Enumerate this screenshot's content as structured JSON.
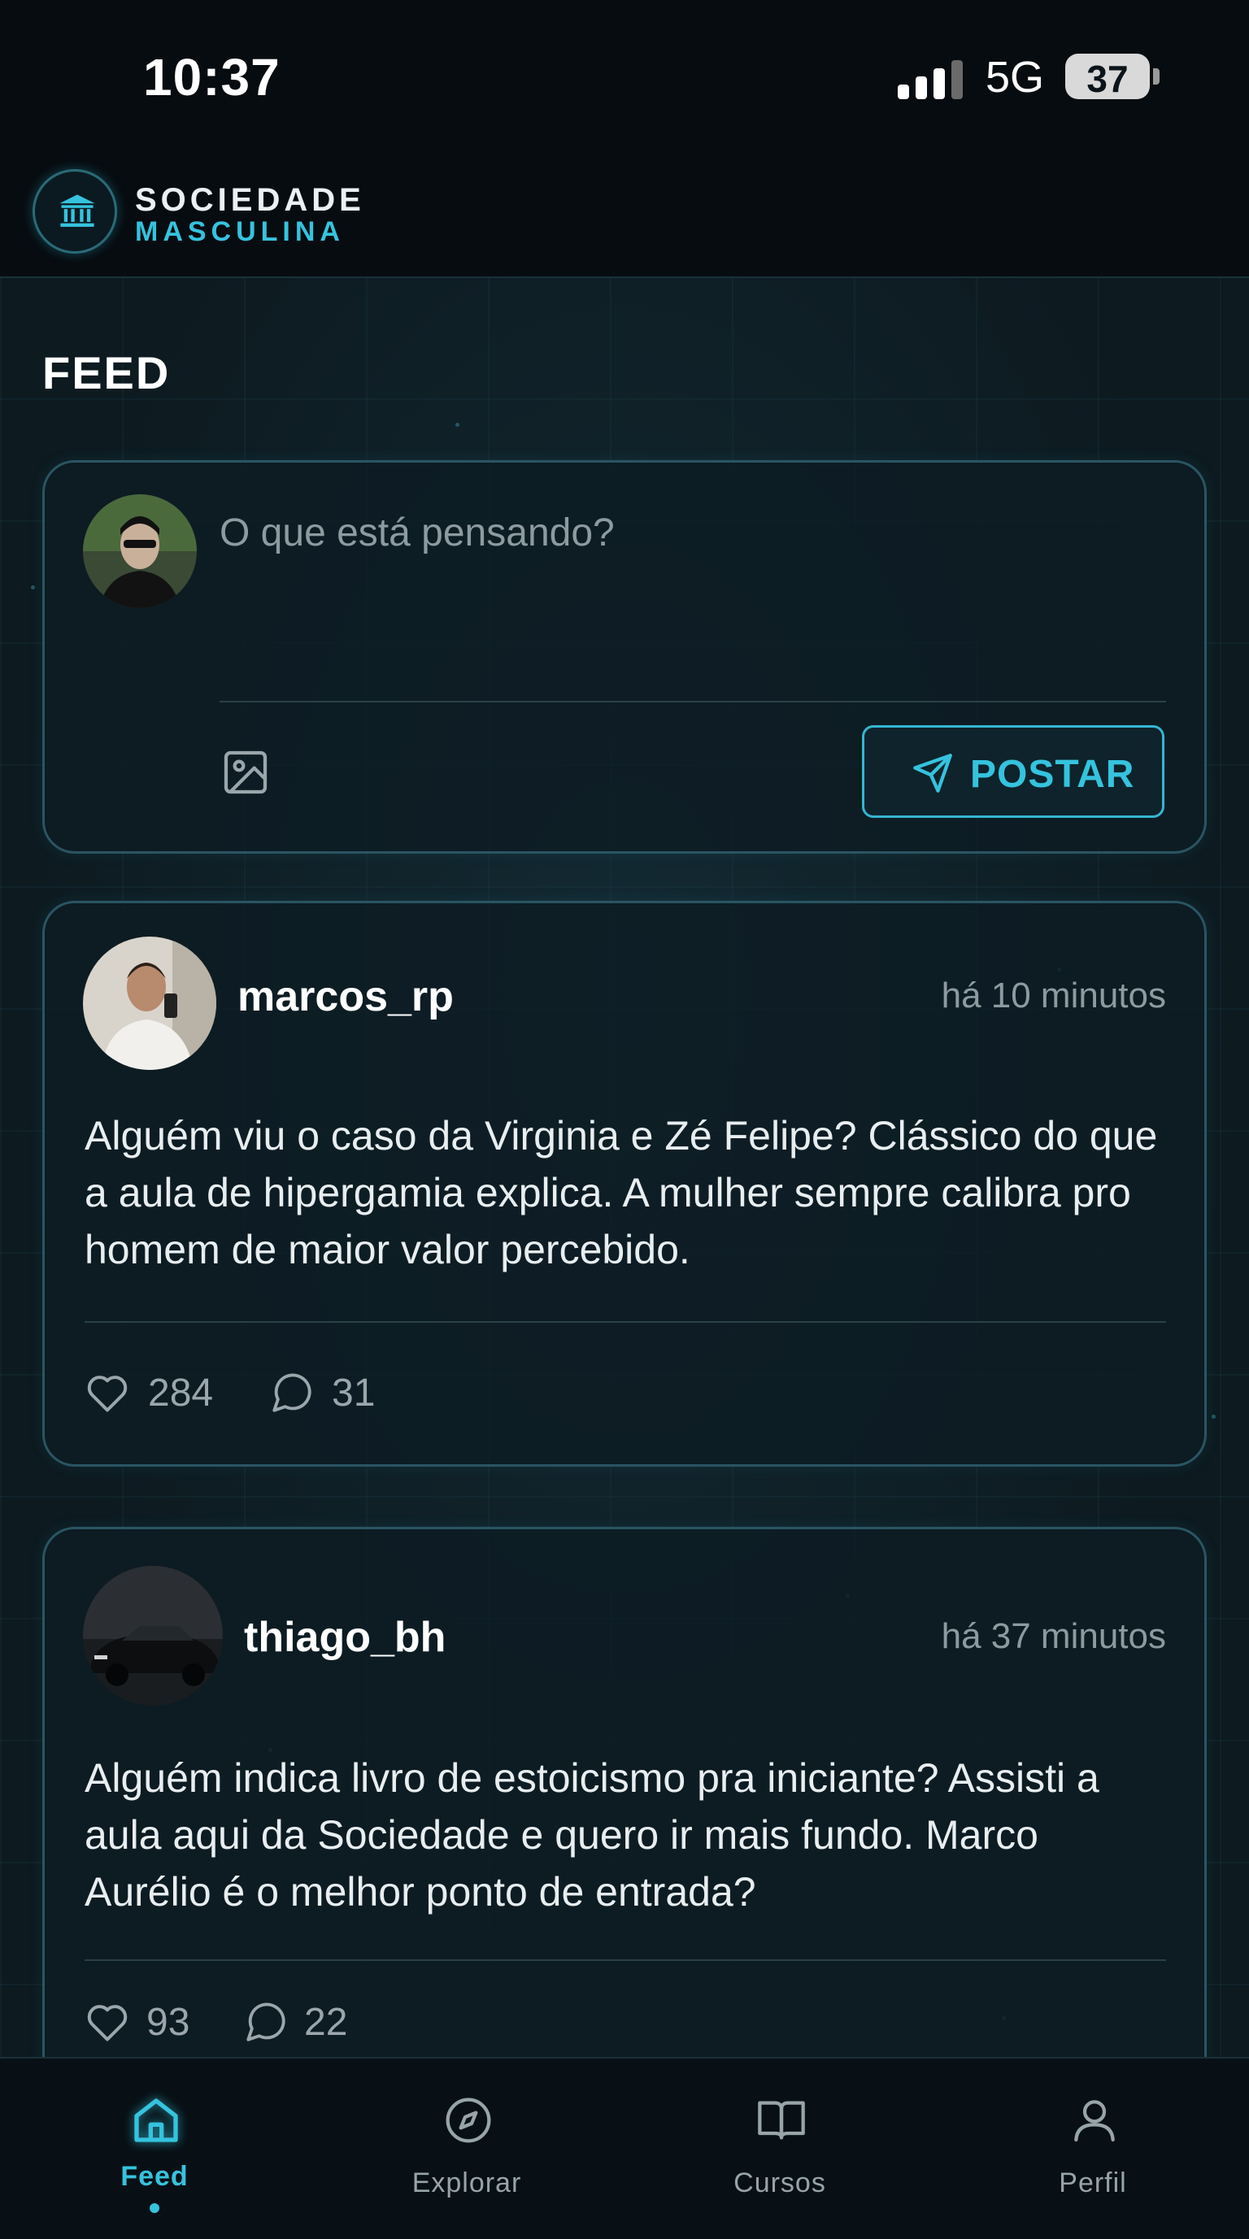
{
  "status_bar": {
    "time": "10:37",
    "network": "5G",
    "battery": "37"
  },
  "header": {
    "brand_line1": "SOCIEDADE",
    "brand_line2": "MASCULINA",
    "logo_icon": "bank-icon"
  },
  "page_title": "FEED",
  "composer": {
    "placeholder": "O que está pensando?",
    "post_label": "POSTAR",
    "image_icon": "image-icon",
    "send_icon": "send-icon"
  },
  "posts": [
    {
      "username": "marcos_rp",
      "time": "há 10 minutos",
      "body": "Alguém viu o caso da Virginia e Zé Felipe? Clássico do que a aula de hipergamia explica. A mulher sempre calibra pro homem de maior valor percebido.",
      "likes": "284",
      "comments": "31"
    },
    {
      "username": "thiago_bh",
      "time": "há 37 minutos",
      "body": "Alguém indica livro de estoicismo pra iniciante? Assisti a aula aqui da Sociedade e quero ir mais fundo. Marco Aurélio é o melhor ponto de entrada?",
      "likes": "93",
      "comments": "22"
    }
  ],
  "tabs": [
    {
      "label": "Feed",
      "icon": "home-icon",
      "active": true
    },
    {
      "label": "Explorar",
      "icon": "compass-icon",
      "active": false
    },
    {
      "label": "Cursos",
      "icon": "book-icon",
      "active": false
    },
    {
      "label": "Perfil",
      "icon": "user-icon",
      "active": false
    }
  ],
  "colors": {
    "accent": "#35c3de",
    "background": "#0d1a20",
    "card_border": "#2a5563"
  }
}
